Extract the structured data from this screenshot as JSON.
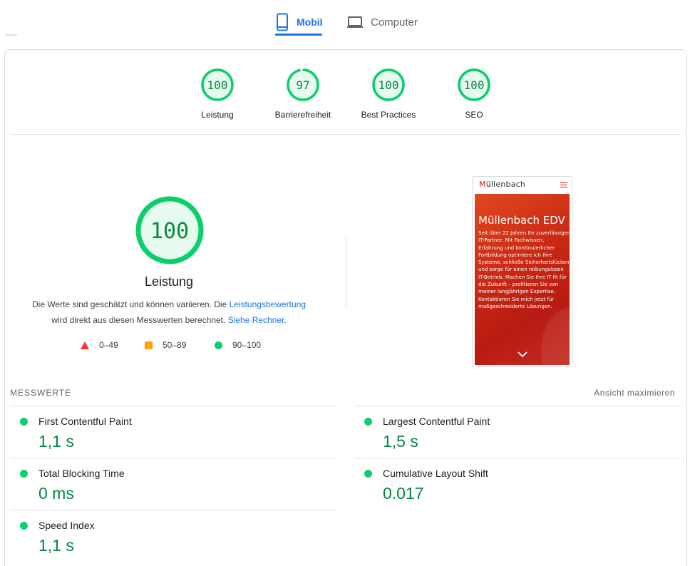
{
  "tabs": {
    "mobile": "Mobil",
    "desktop": "Computer"
  },
  "colors": {
    "good": "#0cce6b",
    "good_text": "#0c8a3c",
    "average": "#ffa400",
    "poor": "#ff3333",
    "accent": "#1a73e8"
  },
  "categories": [
    {
      "label": "Leistung",
      "score": 100
    },
    {
      "label": "Barrierefreiheit",
      "score": 97
    },
    {
      "label": "Best Practices",
      "score": 100
    },
    {
      "label": "SEO",
      "score": 100
    }
  ],
  "performance": {
    "score": 100,
    "title": "Leistung",
    "desc_text1": "Die Werte sind geschätzt und können variieren. Die ",
    "desc_link1": "Leistungsbewertung",
    "desc_text2": "wird direkt aus diesen Messwerten berechnet. ",
    "desc_link2": "Siehe Rechner",
    "desc_end": "."
  },
  "legend": {
    "poor": "0–49",
    "average": "50–89",
    "good": "90–100"
  },
  "screenshot": {
    "logo_left": "M",
    "logo_right": "üllenbach",
    "heading": "Müllenbach EDV",
    "body": "Seit über 22 Jahren Ihr zuverlässiger IT-Partner. Mit Fachwissen, Erfahrung und kontinuierlicher Fortbildung optimiere ich Ihre Systeme, schließe Sicherheitslücken und sorge für einen reibungslosen IT-Betrieb. Machen Sie Ihre IT fit für die Zukunft – profitieren Sie von meiner langjährigen Expertise. Kontaktieren Sie mich jetzt für maßgeschneiderte Lösungen."
  },
  "metrics": {
    "title": "MESSWERTE",
    "expand": "Ansicht maximieren",
    "items": [
      {
        "name": "First Contentful Paint",
        "value": "1,1 s"
      },
      {
        "name": "Largest Contentful Paint",
        "value": "1,5 s"
      },
      {
        "name": "Total Blocking Time",
        "value": "0 ms"
      },
      {
        "name": "Cumulative Layout Shift",
        "value": "0.017"
      },
      {
        "name": "Speed Index",
        "value": "1,1 s"
      }
    ]
  }
}
